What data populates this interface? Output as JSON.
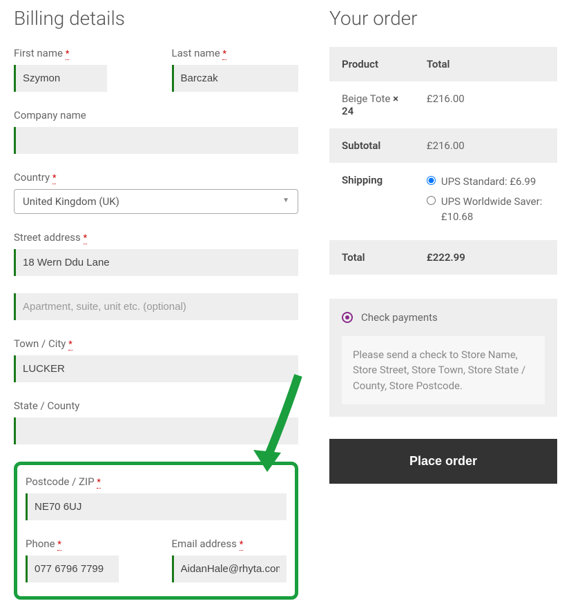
{
  "billing": {
    "heading": "Billing details",
    "first_name_label": "First name",
    "first_name_value": "Szymon",
    "last_name_label": "Last name",
    "last_name_value": "Barczak",
    "company_label": "Company name",
    "company_value": "",
    "country_label": "Country",
    "country_value": "United Kingdom (UK)",
    "street_label": "Street address",
    "street1_value": "18 Wern Ddu Lane",
    "street2_placeholder": "Apartment, suite, unit etc. (optional)",
    "city_label": "Town / City",
    "city_value": "LUCKER",
    "state_label": "State / County",
    "state_value": "",
    "postcode_label": "Postcode / ZIP",
    "postcode_value": "NE70 6UJ",
    "phone_label": "Phone",
    "phone_value": "077 6796 7799",
    "email_label": "Email address",
    "email_value": "AidanHale@rhyta.com",
    "required_mark": "*"
  },
  "order": {
    "heading": "Your order",
    "col_product": "Product",
    "col_total": "Total",
    "item_name": "Beige Tote ",
    "item_qty_prefix": "× ",
    "item_qty": "24",
    "item_total": "£216.00",
    "subtotal_label": "Subtotal",
    "subtotal_value": "£216.00",
    "shipping_label": "Shipping",
    "ship_opt1": "UPS Standard: £6.99",
    "ship_opt2": "UPS Worldwide Saver: £10.68",
    "total_label": "Total",
    "total_value": "£222.99"
  },
  "payment": {
    "method_label": "Check payments",
    "desc": "Please send a check to Store Name, Store Street, Store Town, Store State / County, Store Postcode.",
    "place_button": "Place order"
  }
}
